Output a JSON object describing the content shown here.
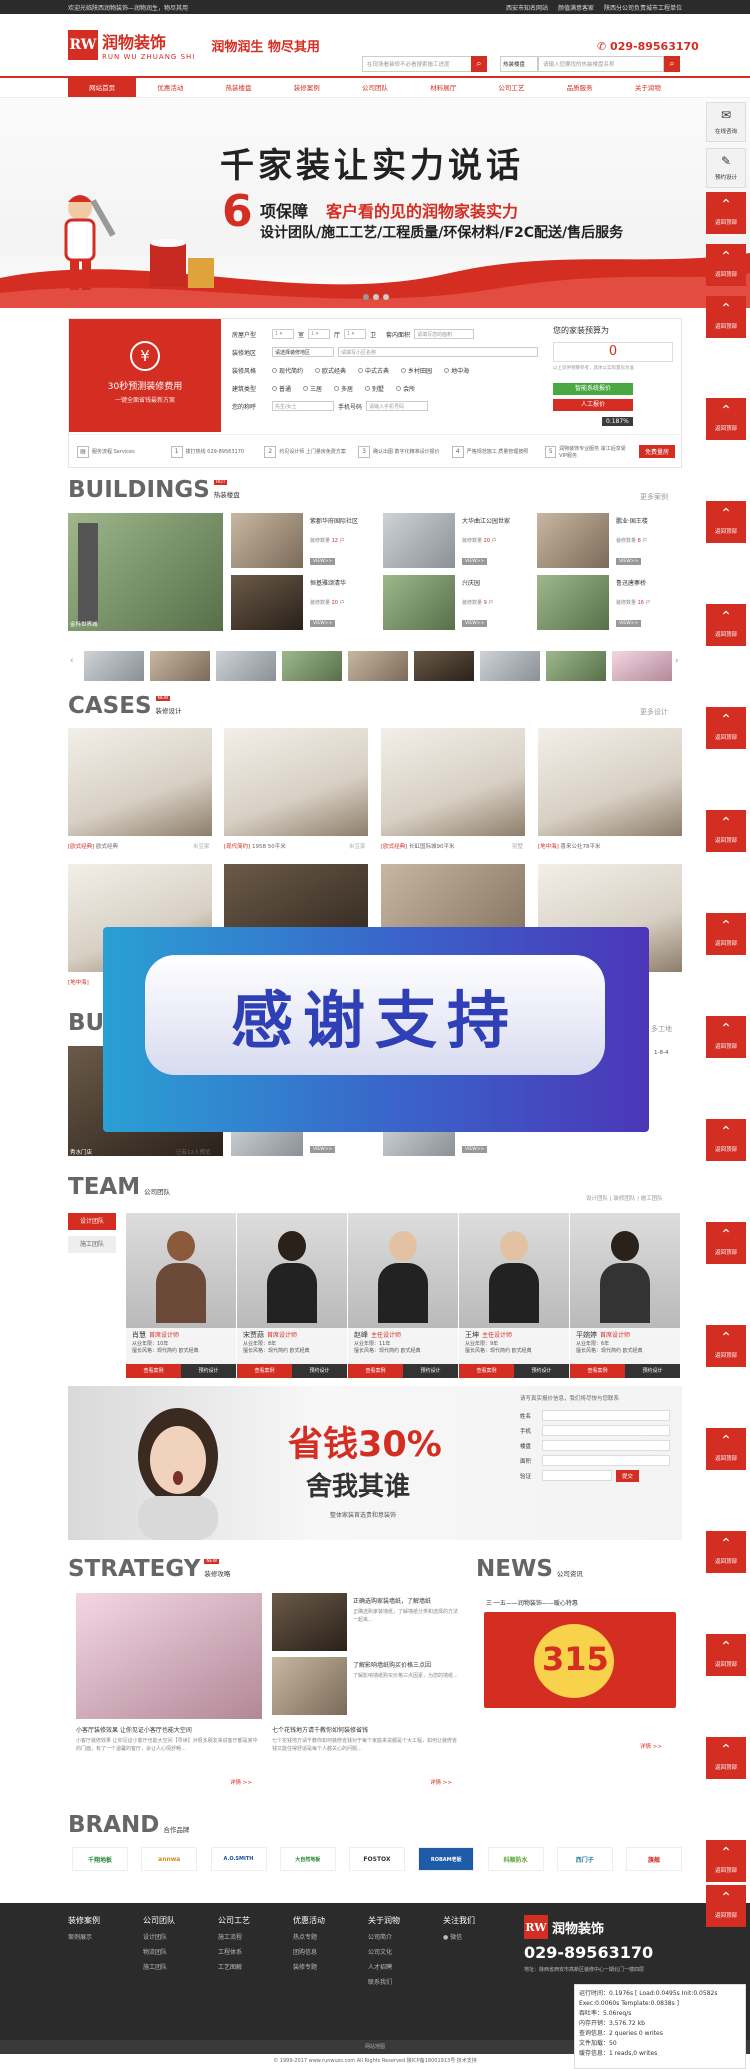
{
  "topbar": {
    "welcome": "欢迎光临陕西润物装饰—润物润生，物尽其用",
    "links": [
      "西安市知名网站",
      "颜值满意客家",
      "陕西分公司负责城市工程单位"
    ]
  },
  "header": {
    "brand_cn": "润物装饰",
    "brand_en": "RUN WU ZHUANG SHI",
    "slogan": "润物润生 物尽其用",
    "search_placeholder": "在现场看装修不必看搜索施工进度",
    "search2_select": "热装楼盘",
    "search2_placeholder": "请输入您要找的热装楼盘名称",
    "phone": "029-89563170"
  },
  "nav": [
    "网站首页",
    "优惠活动",
    "热装楼盘",
    "装修案例",
    "公司团队",
    "材料展厅",
    "公司工艺",
    "品质服务",
    "关于润物"
  ],
  "banner": {
    "title": "千家装让实力说话",
    "six": "6",
    "sub1a": "项保障",
    "sub1b": "客户看的见的润物家装实力",
    "sub2": "设计团队/施工工艺/工程质量/环保材料/F2C配送/售后服务"
  },
  "calc": {
    "left_title": "30秒预测装修费用",
    "left_sub": "一键全面省钱最新方案",
    "rows": {
      "room": "房屋户型",
      "area": "装修地区",
      "area_select": "请选择装修地区",
      "area_placeholder": "请填写小区名称",
      "style": "装修风格",
      "styles": [
        "现代简约",
        "欧式经典",
        "中式古典",
        "乡村田园",
        "地中海"
      ],
      "type": "建筑类型",
      "types": [
        "普通",
        "三居",
        "多居",
        "别墅",
        "会所"
      ],
      "contact": "您的称呼",
      "contact_placeholder": "先生/女士",
      "mobile": "手机号码",
      "mobile_placeholder": "请输入手机号码",
      "units": [
        "室",
        "厅",
        "卫"
      ],
      "inner_area": "套内面积",
      "inner_area_placeholder": "请填写您的面积"
    },
    "right_title": "您的家装预算为",
    "right_value": "0",
    "right_note": "以上仅供预算参考，具体以实际量房为准",
    "right_btn1": "智能系统报价",
    "right_btn2": "人工报价",
    "badge": "0.187%",
    "steps": [
      {
        "n": "1",
        "t": "服务流程 Services"
      },
      {
        "n": "1",
        "t": "拨打热线 029-89563170"
      },
      {
        "n": "2",
        "t": "约见设计师 上门量房免费方案"
      },
      {
        "n": "3",
        "t": "确认出图 数字化精准设计报价"
      },
      {
        "n": "4",
        "t": "严格规范施工 质量管理按照"
      },
      {
        "n": "5",
        "t": "润物装饰专业服务 竣工后享受VIP服务"
      }
    ],
    "free_btn": "免费量房"
  },
  "buildings": {
    "en": "BUILDINGS",
    "cn": "热装楼盘",
    "tag": "HOT",
    "more": "更多案例",
    "big_caption": "金科世界城",
    "cards": [
      {
        "title": "紫郡华府国际社区",
        "meta1": "装修数量",
        "num": "12",
        "unit": "户"
      },
      {
        "title": "大华曲江公园世家",
        "meta1": "装修数量",
        "num": "20",
        "unit": "户"
      },
      {
        "title": "鹏业·国王楼",
        "meta1": "装修数量",
        "num": "8",
        "unit": "户"
      },
      {
        "title": "恒基雅颂清华",
        "meta1": "装修数量",
        "num": "20",
        "unit": "户"
      },
      {
        "title": "兴庆园",
        "meta1": "装修数量",
        "num": "9",
        "unit": "户"
      },
      {
        "title": "鲁迅唐寨桥",
        "meta1": "装修数量",
        "num": "16",
        "unit": "户"
      }
    ],
    "view_label": "VIEW>>"
  },
  "cases": {
    "en": "CASES",
    "cn": "装修设计",
    "tag": "NEW",
    "more": "更多设计",
    "captions": [
      {
        "tag": "[欧式经典]",
        "title": "欧式经典",
        "right": "米豆家"
      },
      {
        "tag": "[现代简约]",
        "title": "1958 50平米",
        "right": "米豆家"
      },
      {
        "tag": "[欧式经典]",
        "title": "长虹国际城90平米",
        "right": "别墅"
      },
      {
        "tag": "[地中海]",
        "title": "喜来公社78平米",
        "right": ""
      }
    ],
    "caption5": "[地中海]"
  },
  "overlay": {
    "text": "感谢支持"
  },
  "buildings2": {
    "en": "BU",
    "more_partial": "多工地",
    "side_text": "1-8-4",
    "cap1": "秀水门店",
    "cap2": "已有12人预览",
    "view_label": "VIEW>>"
  },
  "team": {
    "en": "TEAM",
    "cn": "公司团队",
    "tabs": [
      "设计团队",
      "施工团队"
    ],
    "filters": "设计团队 | 装修团队 | 施工团队",
    "members": [
      {
        "name": "肖慧",
        "role": "首席设计师",
        "exp": "从业年限：10年",
        "style": "擅长风格：现代简约 欧式经典"
      },
      {
        "name": "宋贾蒜",
        "role": "首席设计师",
        "exp": "从业年限：8年",
        "style": "擅长风格：现代简约 欧式经典"
      },
      {
        "name": "赵峰",
        "role": "主任设计师",
        "exp": "从业年限：11年",
        "style": "擅长风格：现代简约 欧式经典"
      },
      {
        "name": "王坤",
        "role": "主任设计师",
        "exp": "从业年限：9年",
        "style": "擅长风格：现代简约 欧式经典"
      },
      {
        "name": "平婉婷",
        "role": "首席设计师",
        "exp": "从业年限：6年",
        "style": "擅长风格：现代简约 欧式经典"
      }
    ],
    "btn_case": "查看案例",
    "btn_book": "预约设计"
  },
  "ad": {
    "big1": "省钱30%",
    "big2": "舍我其谁",
    "small": "整体家装首选贵和意装饰",
    "form_title": "请写真实报价信息，我们将尽快与您联系",
    "fields": [
      "姓名",
      "手机",
      "楼盘",
      "面积",
      "验证"
    ],
    "submit": "提交"
  },
  "strategy": {
    "en": "STRATEGY",
    "cn": "装修攻略",
    "tag": "NEW",
    "items": [
      {
        "title": "正确选购家装墙纸，了解墙纸",
        "desc": "正确选购家装墙纸，了解墙纸分类和选择的方法一起来..."
      },
      {
        "title": "了解影响墙纸购买价格三点因",
        "desc": "了解影响墙纸购买价格三点因素，为您的墙纸..."
      }
    ],
    "big_title": "小客厅装修效果 让你见证小客厅也能大空间",
    "big_desc": "小客厅装修效果 让你见证小客厅也能大空间【导读】对很多朋友来说客厅都是家中的门面，有了一个温馨的客厅，会让人心情舒畅...",
    "mid_title": "七个花钱地方请千教你如何装修省钱",
    "mid_desc": "七个花钱地方请千教你如何装修省钱对于每个家庭来说都是个大工程，如何让装修省钱又能住得舒适是每个人都关心的问题...",
    "more": "详情 >>"
  },
  "news": {
    "en": "NEWS",
    "cn": "公司资讯",
    "headline": "三·一五——润物装饰——暖心特惠",
    "poster": "315",
    "more": "详情 >>"
  },
  "brand": {
    "en": "BRAND",
    "cn": "合作品牌",
    "logos": [
      "千翔地板",
      "annwa",
      "A.O.SMITH",
      "大自然地板",
      "FOSTOX",
      "ROBAM老板",
      "科顺防水",
      "西门子",
      "旗舰"
    ]
  },
  "footer": {
    "cols": [
      {
        "h": "装修案例",
        "items": [
          "案例展示"
        ]
      },
      {
        "h": "公司团队",
        "items": [
          "设计团队",
          "物流团队",
          "施工团队"
        ]
      },
      {
        "h": "公司工艺",
        "items": [
          "施工流程",
          "工程体系",
          "工艺图解"
        ]
      },
      {
        "h": "优惠活动",
        "items": [
          "热点专题",
          "团购信息",
          "装修专题"
        ]
      },
      {
        "h": "关于润物",
        "items": [
          "公司简介",
          "公司文化",
          "人才招聘",
          "联系我们"
        ]
      },
      {
        "h": "关注我们",
        "items": [
          "微信"
        ]
      }
    ],
    "phone": "029-89563170",
    "address": "地址：陕西省西安市高新区装修中心一期北门一楼四层",
    "sitemap": "网站地图",
    "copyright": "© 1999-2017 www.runwuzs.com All Rights Reserved 陕ICP备18001913号 技术支持"
  },
  "debug": {
    "lines": [
      "运行时间：0.1976s [ Load:0.0495s Init:0.0582s",
      "Exec:0.0060s Template:0.0838s ]",
      "吞吐率：5.06req/s",
      "内存开销：3,576.72 kb",
      "查询信息：2 queries 0 writes",
      "文件加载：50",
      "缓存信息：1 reads,0 writes"
    ]
  },
  "float": {
    "online": "在线咨询",
    "design": "预约设计",
    "back": "返回顶部"
  }
}
